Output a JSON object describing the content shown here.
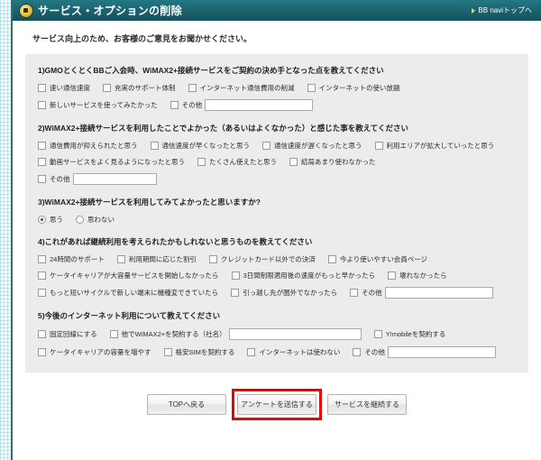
{
  "header": {
    "title": "サービス・オプションの削除",
    "icon": "gold-circle-icon",
    "nav_arrow": "triangle-right-icon",
    "nav_link": "BB naviトップへ",
    "bg_color": "#1d6672"
  },
  "lead": "サービス向上のため、お客様のご意見をお聞かせください。",
  "questions": [
    {
      "title": "1)GMOとくとくBBご入会時、WiMAX2+接続サービスをご契約の決め手となった点を教えてください",
      "rows": [
        [
          {
            "type": "checkbox",
            "label": "速い通信速度"
          },
          {
            "type": "checkbox",
            "label": "充実のサポート体制"
          },
          {
            "type": "checkbox",
            "label": "インターネット通信費用の削減"
          },
          {
            "type": "checkbox",
            "label": "インターネットの使い放題"
          }
        ],
        [
          {
            "type": "checkbox",
            "label": "新しいサービスを使ってみたかった"
          },
          {
            "type": "checkbox",
            "label": "その他",
            "text_input": true,
            "text_value": "",
            "text_size": "md"
          }
        ]
      ]
    },
    {
      "title": "2)WiMAX2+接続サービスを利用したことでよかった（あるいはよくなかった）と感じた事を教えてください",
      "rows": [
        [
          {
            "type": "checkbox",
            "label": "通信費用が抑えられたと思う"
          },
          {
            "type": "checkbox",
            "label": "通信速度が早くなったと思う"
          },
          {
            "type": "checkbox",
            "label": "通信速度が遅くなったと思う"
          },
          {
            "type": "checkbox",
            "label": "利用エリアが拡大していったと思う"
          }
        ],
        [
          {
            "type": "checkbox",
            "label": "動画サービスをよく見るようになったと思う"
          },
          {
            "type": "checkbox",
            "label": "たくさん使えたと思う"
          },
          {
            "type": "checkbox",
            "label": "結局あまり使わなかった"
          }
        ],
        [
          {
            "type": "checkbox",
            "label": "その他",
            "text_input": true,
            "text_value": "",
            "text_size": "sm"
          }
        ]
      ]
    },
    {
      "title": "3)WiMAX2+接続サービスを利用してみてよかったと思いますか?",
      "rows": [
        [
          {
            "type": "radio",
            "label": "思う",
            "checked": true
          },
          {
            "type": "radio",
            "label": "思わない",
            "checked": false
          }
        ]
      ]
    },
    {
      "title": "4)これがあれば継続利用を考えられたかもしれないと思うものを教えてください",
      "rows": [
        [
          {
            "type": "checkbox",
            "label": "24時間のサポート"
          },
          {
            "type": "checkbox",
            "label": "利用期間に応じた割引"
          },
          {
            "type": "checkbox",
            "label": "クレジットカード以外での決済"
          },
          {
            "type": "checkbox",
            "label": "今より使いやすい会員ページ"
          }
        ],
        [
          {
            "type": "checkbox",
            "label": "ケータイキャリアが大容量サービスを開始しなかったら"
          },
          {
            "type": "checkbox",
            "label": "3日間制限適用後の速度がもっと早かったら"
          },
          {
            "type": "checkbox",
            "label": "壊れなかったら"
          }
        ],
        [
          {
            "type": "checkbox",
            "label": "もっと短いサイクルで新しい端末に機種変できていたら"
          },
          {
            "type": "checkbox",
            "label": "引っ越し先が圏外でなかったら"
          },
          {
            "type": "checkbox",
            "label": "その他",
            "text_input": true,
            "text_value": "",
            "text_size": "md"
          }
        ]
      ]
    },
    {
      "title": "5)今後のインターネット利用について教えてください",
      "rows": [
        [
          {
            "type": "checkbox",
            "label": "固定回線にする"
          },
          {
            "type": "checkbox",
            "label": "他でWiMAX2+を契約する（社名）",
            "text_input": true,
            "text_value": "",
            "text_size": "lg"
          },
          {
            "type": "checkbox",
            "label": "Y!mobileを契約する"
          }
        ],
        [
          {
            "type": "checkbox",
            "label": "ケータイキャリアの容量を増やす"
          },
          {
            "type": "checkbox",
            "label": "格安SIMを契約する"
          },
          {
            "type": "checkbox",
            "label": "インターネットは使わない"
          },
          {
            "type": "checkbox",
            "label": "その他",
            "text_input": true,
            "text_value": "",
            "text_size": "md"
          }
        ]
      ]
    }
  ],
  "footer": {
    "back_label": "TOPへ戻る",
    "submit_label": "アンケートを送信する",
    "continue_label": "サービスを継続する",
    "highlight_color": "#ee0000"
  }
}
